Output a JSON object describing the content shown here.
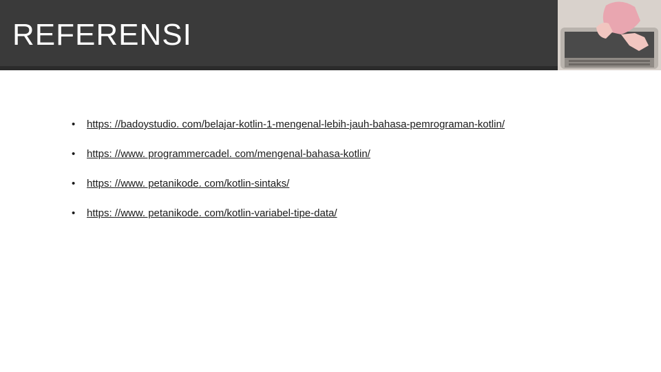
{
  "header": {
    "title": "REFERENSI"
  },
  "references": [
    {
      "text": "https: //badoystudio. com/belajar-kotlin-1-mengenal-lebih-jauh-bahasa-pemrograman-kotlin/"
    },
    {
      "text": "https: //www. programmercadel. com/mengenal-bahasa-kotlin/"
    },
    {
      "text": "https: //www. petanikode. com/kotlin-sintaks/"
    },
    {
      "text": "https: //www. petanikode. com/kotlin-variabel-tipe-data/"
    }
  ]
}
